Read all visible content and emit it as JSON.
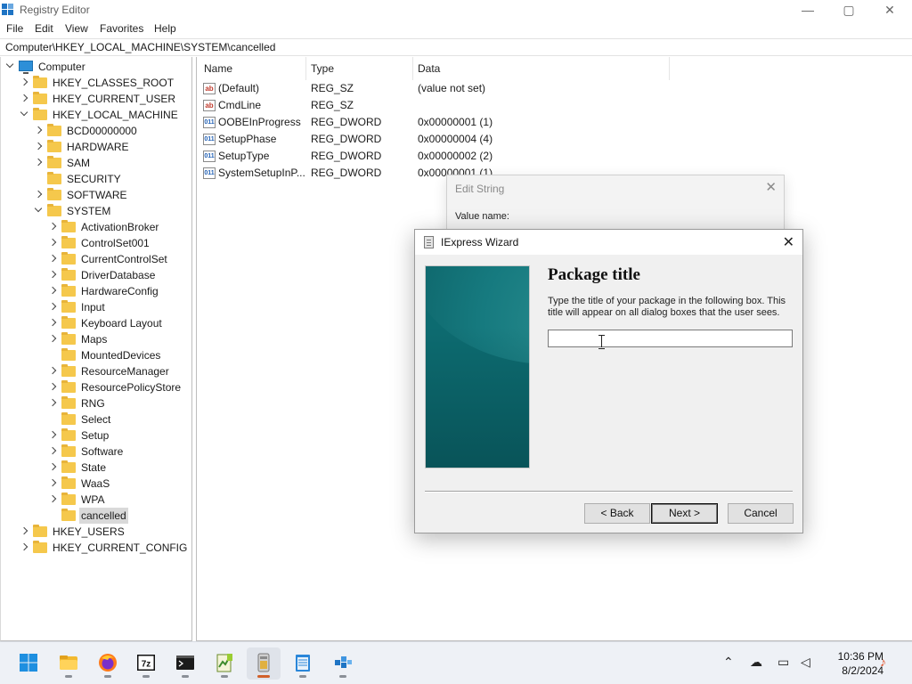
{
  "window": {
    "title": "Registry Editor",
    "controls": [
      "—",
      "▢",
      "✕"
    ]
  },
  "menu": [
    "File",
    "Edit",
    "View",
    "Favorites",
    "Help"
  ],
  "address": "Computer\\HKEY_LOCAL_MACHINE\\SYSTEM\\cancelled",
  "tree": [
    {
      "label": "Computer",
      "depth": 0,
      "chevron": "down",
      "icon": "computer"
    },
    {
      "label": "HKEY_CLASSES_ROOT",
      "depth": 1,
      "chevron": "right",
      "icon": "folder"
    },
    {
      "label": "HKEY_CURRENT_USER",
      "depth": 1,
      "chevron": "right",
      "icon": "folder"
    },
    {
      "label": "HKEY_LOCAL_MACHINE",
      "depth": 1,
      "chevron": "down",
      "icon": "folder"
    },
    {
      "label": "BCD00000000",
      "depth": 2,
      "chevron": "right",
      "icon": "folder"
    },
    {
      "label": "HARDWARE",
      "depth": 2,
      "chevron": "right",
      "icon": "folder"
    },
    {
      "label": "SAM",
      "depth": 2,
      "chevron": "right",
      "icon": "folder"
    },
    {
      "label": "SECURITY",
      "depth": 2,
      "chevron": "none",
      "icon": "folder"
    },
    {
      "label": "SOFTWARE",
      "depth": 2,
      "chevron": "right",
      "icon": "folder"
    },
    {
      "label": "SYSTEM",
      "depth": 2,
      "chevron": "down",
      "icon": "folder"
    },
    {
      "label": "ActivationBroker",
      "depth": 3,
      "chevron": "right",
      "icon": "folder"
    },
    {
      "label": "ControlSet001",
      "depth": 3,
      "chevron": "right",
      "icon": "folder"
    },
    {
      "label": "CurrentControlSet",
      "depth": 3,
      "chevron": "right",
      "icon": "folder"
    },
    {
      "label": "DriverDatabase",
      "depth": 3,
      "chevron": "right",
      "icon": "folder"
    },
    {
      "label": "HardwareConfig",
      "depth": 3,
      "chevron": "right",
      "icon": "folder"
    },
    {
      "label": "Input",
      "depth": 3,
      "chevron": "right",
      "icon": "folder"
    },
    {
      "label": "Keyboard Layout",
      "depth": 3,
      "chevron": "right",
      "icon": "folder"
    },
    {
      "label": "Maps",
      "depth": 3,
      "chevron": "right",
      "icon": "folder"
    },
    {
      "label": "MountedDevices",
      "depth": 3,
      "chevron": "none",
      "icon": "folder"
    },
    {
      "label": "ResourceManager",
      "depth": 3,
      "chevron": "right",
      "icon": "folder"
    },
    {
      "label": "ResourcePolicyStore",
      "depth": 3,
      "chevron": "right",
      "icon": "folder"
    },
    {
      "label": "RNG",
      "depth": 3,
      "chevron": "right",
      "icon": "folder"
    },
    {
      "label": "Select",
      "depth": 3,
      "chevron": "none",
      "icon": "folder"
    },
    {
      "label": "Setup",
      "depth": 3,
      "chevron": "right",
      "icon": "folder"
    },
    {
      "label": "Software",
      "depth": 3,
      "chevron": "right",
      "icon": "folder"
    },
    {
      "label": "State",
      "depth": 3,
      "chevron": "right",
      "icon": "folder"
    },
    {
      "label": "WaaS",
      "depth": 3,
      "chevron": "right",
      "icon": "folder"
    },
    {
      "label": "WPA",
      "depth": 3,
      "chevron": "right",
      "icon": "folder"
    },
    {
      "label": "cancelled",
      "depth": 3,
      "chevron": "none",
      "icon": "folder",
      "selected": true
    },
    {
      "label": "HKEY_USERS",
      "depth": 1,
      "chevron": "right",
      "icon": "folder"
    },
    {
      "label": "HKEY_CURRENT_CONFIG",
      "depth": 1,
      "chevron": "right",
      "icon": "folder"
    }
  ],
  "list": {
    "headers": [
      "Name",
      "Type",
      "Data"
    ],
    "rows": [
      {
        "name": "(Default)",
        "type": "REG_SZ",
        "data": "(value not set)",
        "icon": "string-value-icon"
      },
      {
        "name": "CmdLine",
        "type": "REG_SZ",
        "data": "",
        "icon": "string-value-icon"
      },
      {
        "name": "OOBEInProgress",
        "type": "REG_DWORD",
        "data": "0x00000001 (1)",
        "icon": "dword-value-icon"
      },
      {
        "name": "SetupPhase",
        "type": "REG_DWORD",
        "data": "0x00000004 (4)",
        "icon": "dword-value-icon"
      },
      {
        "name": "SetupType",
        "type": "REG_DWORD",
        "data": "0x00000002 (2)",
        "icon": "dword-value-icon"
      },
      {
        "name": "SystemSetupInP...",
        "type": "REG_DWORD",
        "data": "0x00000001 (1)",
        "icon": "dword-value-icon"
      }
    ]
  },
  "edit_string": {
    "title": "Edit String",
    "value_name_label": "Value name:",
    "close": "✕"
  },
  "wizard": {
    "title": "IExpress Wizard",
    "close": "✕",
    "heading": "Package title",
    "description": "Type the title of your package in the following  box.  This title will appear on all dialog boxes that the user sees.",
    "input_value": "",
    "back_label": "< Back",
    "next_label": "Next >",
    "cancel_label": "Cancel"
  },
  "taskbar": {
    "apps": [
      "start",
      "file-explorer",
      "firefox",
      "7zip",
      "terminal",
      "notepad-plus-plus",
      "iexpress",
      "notepad",
      "registry-editor"
    ],
    "clock_time": "10:36 PM",
    "clock_date": "8/2/2024"
  },
  "colors": {
    "accent": "#0067c0",
    "folder": "#f5c84c",
    "wizard_art": "#0d6b70"
  }
}
